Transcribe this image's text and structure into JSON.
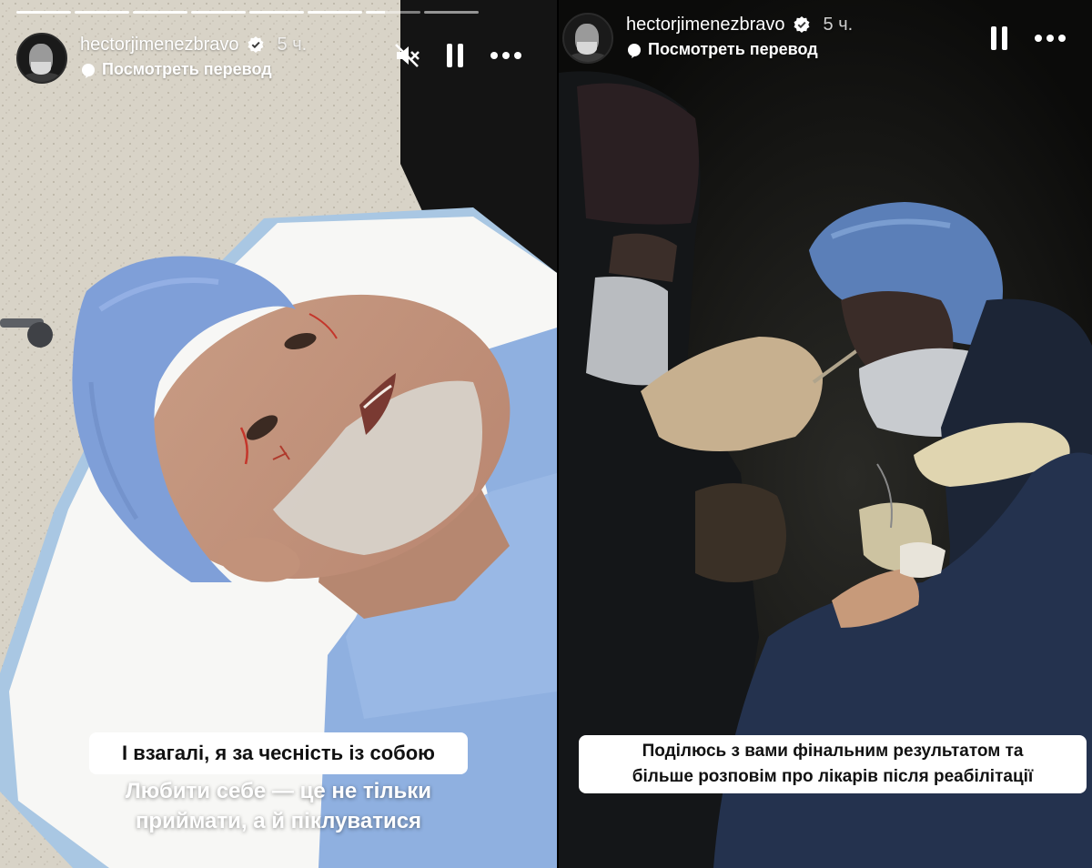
{
  "left_story": {
    "username": "hectorjimenezbravo",
    "time": "5 ч.",
    "translate": "Посмотреть перевод",
    "caption_boxed": "І взагалі, я за чесність із собою",
    "caption_line1": "Любити себе — це не тільки",
    "caption_line2": "приймати, а й піклуватися",
    "icons": [
      "mute-icon",
      "pause-icon",
      "more-icon"
    ]
  },
  "right_story": {
    "username": "hectorjimenezbravo",
    "time": "5 ч.",
    "translate": "Посмотреть перевод",
    "caption_line1": "Поділюсь з вами фінальним результатом та",
    "caption_line2": "більше розповім про лікарів після реабілітації",
    "icons": [
      "pause-icon",
      "more-icon"
    ]
  },
  "colors": {
    "cap_blue": "#7f9fd8",
    "gown_blue": "#8fb0e0",
    "theatre_dark": "#0d0d0b"
  }
}
